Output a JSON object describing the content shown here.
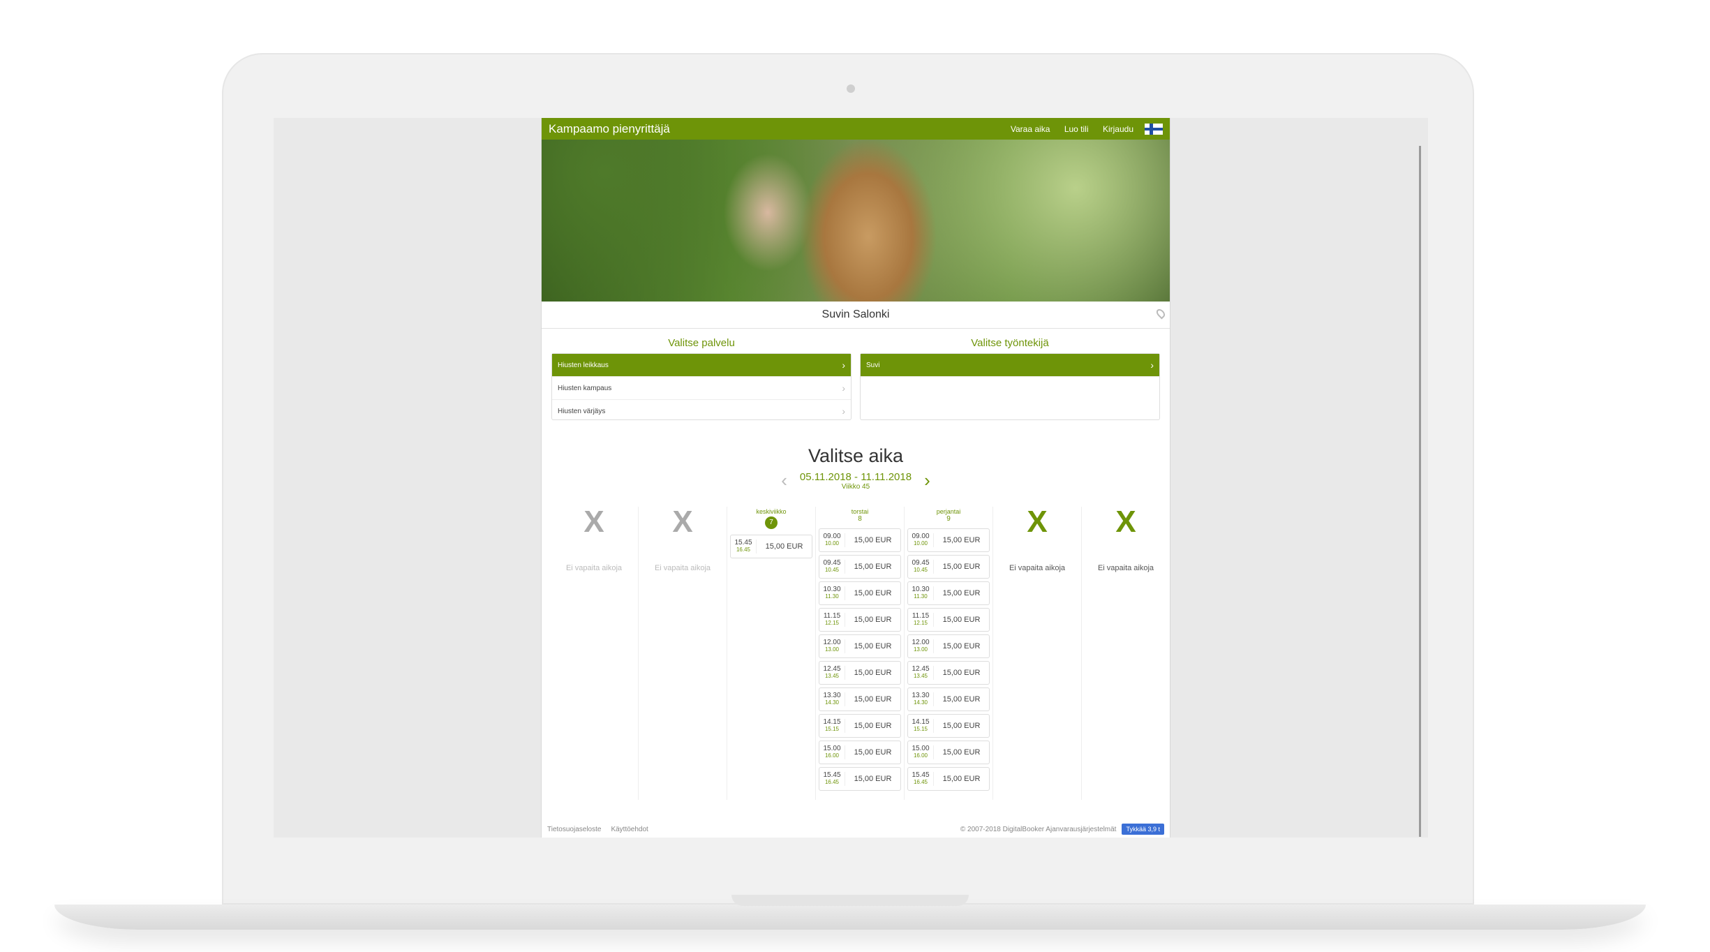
{
  "header": {
    "brand": "Kampaamo pienyrittäjä",
    "nav": [
      "Varaa aika",
      "Luo tili",
      "Kirjaudu"
    ]
  },
  "salon": {
    "name": "Suvin Salonki"
  },
  "service": {
    "title": "Valitse palvelu",
    "options": [
      "Hiusten leikkaus",
      "Hiusten kampaus",
      "Hiusten värjäys"
    ]
  },
  "employee": {
    "title": "Valitse työntekijä",
    "options": [
      "Suvi"
    ]
  },
  "booking": {
    "title": "Valitse aika",
    "range": "05.11.2018 - 11.11.2018",
    "week": "Viikko 45",
    "no_slots": "Ei vapaita aikoja"
  },
  "days": [
    {
      "name": "keskiviikko",
      "num": "7"
    },
    {
      "name": "torstai",
      "num": "8"
    },
    {
      "name": "perjantai",
      "num": "9"
    }
  ],
  "wed_slot": {
    "start": "15.45",
    "end": "16.45",
    "price": "15,00 EUR"
  },
  "slots": [
    {
      "start": "09.00",
      "end": "10.00",
      "price": "15,00 EUR"
    },
    {
      "start": "09.45",
      "end": "10.45",
      "price": "15,00 EUR"
    },
    {
      "start": "10.30",
      "end": "11.30",
      "price": "15,00 EUR"
    },
    {
      "start": "11.15",
      "end": "12.15",
      "price": "15,00 EUR"
    },
    {
      "start": "12.00",
      "end": "13.00",
      "price": "15,00 EUR"
    },
    {
      "start": "12.45",
      "end": "13.45",
      "price": "15,00 EUR"
    },
    {
      "start": "13.30",
      "end": "14.30",
      "price": "15,00 EUR"
    },
    {
      "start": "14.15",
      "end": "15.15",
      "price": "15,00 EUR"
    },
    {
      "start": "15.00",
      "end": "16.00",
      "price": "15,00 EUR"
    },
    {
      "start": "15.45",
      "end": "16.45",
      "price": "15,00 EUR"
    }
  ],
  "footer": {
    "links": [
      "Tietosuojaseloste",
      "Käyttöehdot"
    ],
    "copyright": "© 2007-2018 DigitalBooker Ajanvarausjärjestelmät",
    "like": "Tykkää 3,9 t"
  }
}
